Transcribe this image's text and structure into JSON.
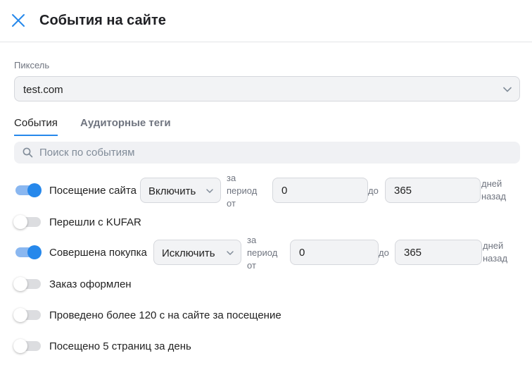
{
  "header": {
    "title": "События на сайте"
  },
  "pixel": {
    "label": "Пиксель",
    "value": "test.com"
  },
  "tabs": [
    {
      "label": "События",
      "active": true
    },
    {
      "label": "Аудиторные теги",
      "active": false
    }
  ],
  "search": {
    "placeholder": "Поиск по событиям",
    "value": ""
  },
  "events": [
    {
      "label": "Посещение сайта",
      "enabled": true,
      "mode": "Включить",
      "period_word1": "за",
      "period_word2": "период",
      "period_word3": "от",
      "from": "0",
      "to_word": "до",
      "to": "365",
      "days_word1": "дней",
      "days_word2": "назад"
    },
    {
      "label": "Перешли с KUFAR",
      "enabled": false
    },
    {
      "label": "Совершена покупка",
      "enabled": true,
      "mode": "Исключить",
      "period_word1": "за",
      "period_word2": "период",
      "period_word3": "от",
      "from": "0",
      "to_word": "до",
      "to": "365",
      "days_word1": "дней",
      "days_word2": "назад"
    },
    {
      "label": "Заказ оформлен",
      "enabled": false
    },
    {
      "label": "Проведено более 120 с на сайте за посещение",
      "enabled": false
    },
    {
      "label": "Посещено 5 страниц за день",
      "enabled": false
    }
  ],
  "colors": {
    "accent": "#2688eb",
    "toggle_on_track": "#8ab7f0",
    "toggle_off_track": "#dcdde0",
    "field_bg": "#f2f3f5"
  },
  "icons": {
    "close": "close-icon",
    "chevron": "chevron-down-icon",
    "search": "search-icon"
  }
}
